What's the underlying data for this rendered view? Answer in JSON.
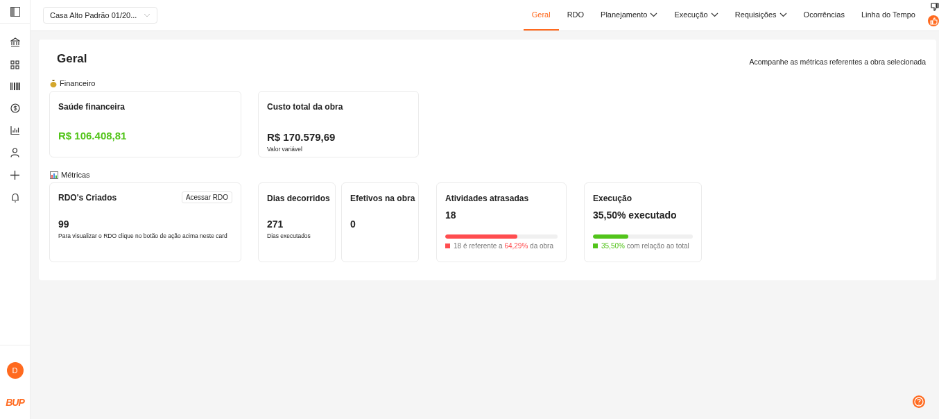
{
  "project_select": {
    "value": "Casa Alto Padrão 01/20..."
  },
  "nav": [
    {
      "label": "Geral",
      "selected": true,
      "has_menu": false
    },
    {
      "label": "RDO",
      "selected": false,
      "has_menu": false
    },
    {
      "label": "Planejamento",
      "selected": false,
      "has_menu": true
    },
    {
      "label": "Execução",
      "selected": false,
      "has_menu": true
    },
    {
      "label": "Requisições",
      "selected": false,
      "has_menu": true
    },
    {
      "label": "Ocorrências",
      "selected": false,
      "has_menu": false
    },
    {
      "label": "Linha do Tempo",
      "selected": false,
      "has_menu": false
    }
  ],
  "page": {
    "title": "Geral",
    "subtitle": "Acompanhe as métricas referentes a obra selecionada"
  },
  "financial": {
    "label": "Financeiro",
    "cards": [
      {
        "title": "Saúde financeira",
        "value": "R$ 106.408,81",
        "highlighted": true
      },
      {
        "title": "Custo total da obra",
        "value": "R$ 170.579,69",
        "highlighted": false,
        "note": "Valor variável"
      }
    ]
  },
  "metrics": {
    "label": "Métricas",
    "cards": [
      {
        "kind": "count",
        "title": "RDO's Criados",
        "button": "Acessar RDO",
        "value": "99",
        "note": "Para visualizar o RDO clique no botão de ação acima neste card"
      },
      {
        "kind": "simple",
        "title": "Dias decorridos",
        "value": "271",
        "note": "Dias executados"
      },
      {
        "kind": "simple",
        "title": "Efetivos na obra",
        "value": "0"
      },
      {
        "kind": "progress",
        "title": "Atividades atrasadas",
        "value": "18",
        "level": 0.6429,
        "color": "#ff4d4f",
        "legend_prefix": "18 é referente a ",
        "legend_highlight": "64,29%",
        "legend_suffix": " da obra"
      },
      {
        "kind": "progress",
        "title": "Execução",
        "value": "35,50% executado",
        "level": 0.355,
        "color": "#52c41a",
        "legend_highlight": "35,50%",
        "legend_suffix": " com relação ao total"
      }
    ]
  },
  "user": {
    "initial": "D"
  },
  "logo": {
    "text": "BUP"
  }
}
